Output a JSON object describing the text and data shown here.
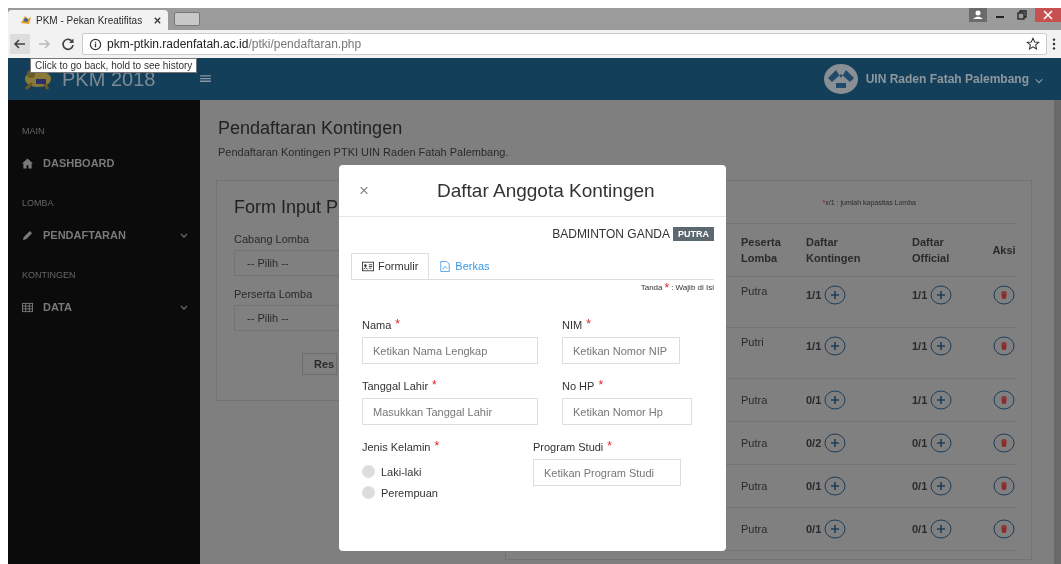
{
  "browser": {
    "tab_title": "PKM - Pekan Kreatifitas",
    "url_host": "pkm-ptkin.radenfatah.ac.id",
    "url_path": "/ptki/pendaftaran.php",
    "tooltip": "Click to go back, hold to see history"
  },
  "header": {
    "brand": "PKM 2018",
    "account": "UIN Raden Fatah Palembang"
  },
  "sidebar": [
    {
      "heading": "MAIN",
      "items": [
        {
          "label": "DASHBOARD",
          "submenu": false
        }
      ]
    },
    {
      "heading": "LOMBA",
      "items": [
        {
          "label": "PENDAFTARAN",
          "submenu": true
        }
      ]
    },
    {
      "heading": "KONTINGEN",
      "items": [
        {
          "label": "DATA",
          "submenu": true
        }
      ]
    }
  ],
  "page": {
    "title": "Pendaftaran Kontingen",
    "subtitle": "Pendaftaran Kontingen PTKI UIN Raden Fatah Palembang."
  },
  "form_card": {
    "title": "Form Input P",
    "fields": [
      {
        "label": "Cabang Lomba",
        "value": "-- Pilih --"
      },
      {
        "label": "Perserta Lomba",
        "value": "-- Pilih --"
      }
    ],
    "button": "Res"
  },
  "table": {
    "note_mark": "*",
    "note": "x/1 : jumlah kapasitas Lomba",
    "columns": [
      "Peserta Lomba",
      "Daftar Kontingen",
      "Daftar Official",
      "Aksi"
    ],
    "rows": [
      {
        "peserta": "Putra",
        "kontingen": "1/1",
        "official": "1/1"
      },
      {
        "peserta": "Putri",
        "kontingen": "1/1",
        "official": "1/1"
      },
      {
        "peserta": "Putra",
        "kontingen": "0/1",
        "official": "1/1"
      },
      {
        "peserta": "Putra",
        "kontingen": "0/2",
        "official": "0/1"
      },
      {
        "peserta": "Putra",
        "kontingen": "0/1",
        "official": "0/1"
      },
      {
        "peserta": "Putra",
        "kontingen": "0/1",
        "official": "0/1"
      }
    ]
  },
  "modal": {
    "close": "×",
    "title": "Daftar Anggota Kontingen",
    "event": "BADMINTON GANDA",
    "badge": "PUTRA",
    "tabs": [
      {
        "label": "Formulir",
        "selected": true
      },
      {
        "label": "Berkas",
        "selected": false
      }
    ],
    "legend": {
      "prefix": "Tanda",
      "mark": "*",
      "text": ": Wajib di Isi"
    },
    "fields": [
      {
        "kind": "text",
        "label": "Nama",
        "mark": "*",
        "placeholder": "Ketikan Nama Lengkap"
      },
      {
        "kind": "text",
        "label": "NIM",
        "mark": "*",
        "placeholder": "Ketikan Nomor NIP"
      },
      {
        "kind": "text",
        "label": "Tanggal Lahir",
        "mark": "*",
        "placeholder": "Masukkan Tanggal Lahir"
      },
      {
        "kind": "text",
        "label": "No HP",
        "mark": "*",
        "placeholder": "Ketikan Nomor Hp"
      },
      {
        "kind": "radio",
        "label": "Jenis Kelamin",
        "mark": "*",
        "options": [
          {
            "label": "Laki-laki",
            "selected": false
          },
          {
            "label": "Perempuan",
            "selected": false
          }
        ]
      },
      {
        "kind": "text",
        "label": "Program Studi",
        "mark": "*",
        "placeholder": "Ketikan Program Studi"
      }
    ]
  }
}
